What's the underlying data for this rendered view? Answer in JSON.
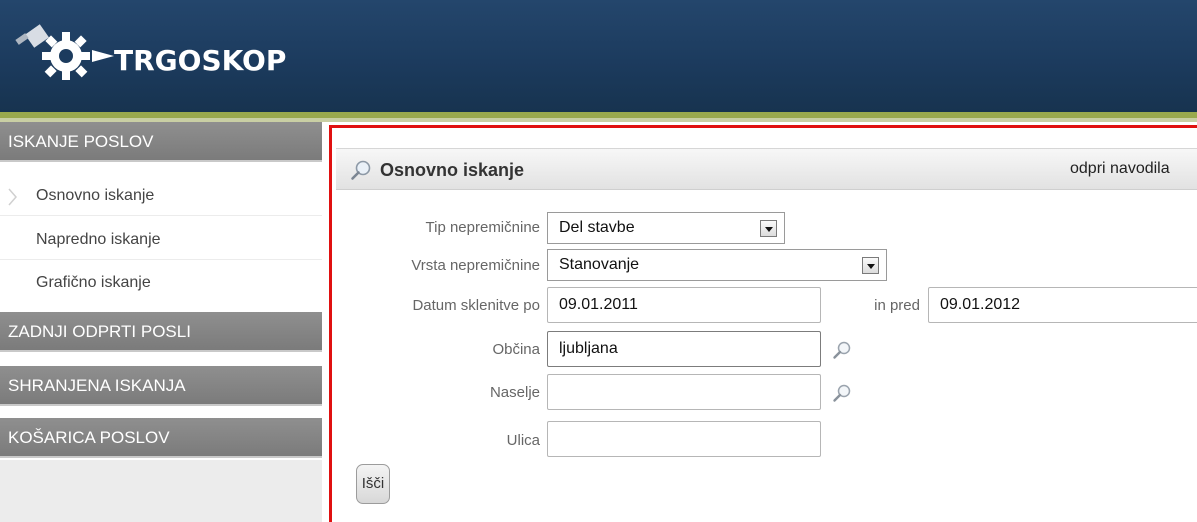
{
  "header": {
    "app_name": "TRGOSKOP"
  },
  "sidebar": {
    "sections": [
      {
        "label": "ISKANJE POSLOV"
      },
      {
        "label": "ZADNJI ODPRTI POSLI"
      },
      {
        "label": "SHRANJENA ISKANJA"
      },
      {
        "label": "KOŠARICA POSLOV"
      }
    ],
    "items": [
      {
        "label": "Osnovno iskanje",
        "active": true
      },
      {
        "label": "Napredno iskanje"
      },
      {
        "label": "Grafično iskanje"
      }
    ]
  },
  "panel": {
    "title": "Osnovno iskanje",
    "help_link": "odpri navodila"
  },
  "form": {
    "tip_label": "Tip nepremičnine",
    "tip_value": "Del stavbe",
    "vrsta_label": "Vrsta nepremičnine",
    "vrsta_value": "Stanovanje",
    "datum_label": "Datum sklenitve po",
    "datum_value": "09.01.2011",
    "pred_label": "in pred",
    "pred_value": "09.01.2012",
    "obcina_label": "Občina",
    "obcina_value": "ljubljana",
    "naselje_label": "Naselje",
    "naselje_value": "",
    "ulica_label": "Ulica",
    "ulica_value": "",
    "search_button": "Išči"
  },
  "colors": {
    "header_bg": "#1c3b5e",
    "accent_stripe": "#9aa94e",
    "sidebar_head": "#808080",
    "frame_red": "#e01010"
  },
  "icons": [
    "logo-gear-icon",
    "magnifier-icon",
    "chevron-right-icon",
    "dropdown-arrow-icon"
  ]
}
